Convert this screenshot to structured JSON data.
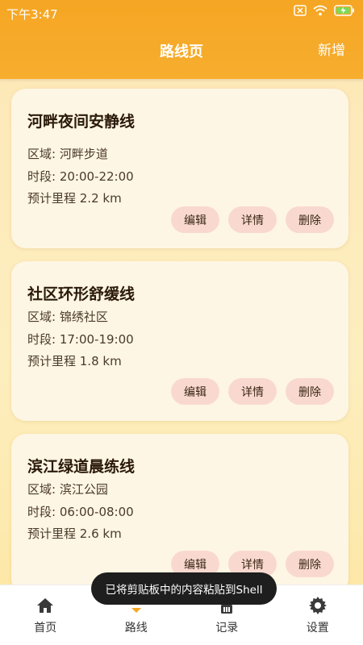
{
  "status_bar": {
    "time": "下午3:47"
  },
  "header": {
    "title": "路线页",
    "add_label": "新增"
  },
  "routes": [
    {
      "name": "河畔夜间安静线",
      "area": "区域: 河畔步道",
      "time": "时段: 20:00-22:00",
      "distance": "预计里程 2.2 km"
    },
    {
      "name": "社区环形舒缓线",
      "area": "区域: 锦绣社区",
      "time": "时段: 17:00-19:00",
      "distance": "预计里程 1.8 km"
    },
    {
      "name": "滨江绿道晨练线",
      "area": "区域: 滨江公园",
      "time": "时段: 06:00-08:00",
      "distance": "预计里程 2.6 km"
    }
  ],
  "actions": {
    "edit": "编辑",
    "details": "详情",
    "delete": "删除"
  },
  "tabs": [
    {
      "label": "首页",
      "icon": "home-icon"
    },
    {
      "label": "路线",
      "icon": "route-icon"
    },
    {
      "label": "记录",
      "icon": "record-icon"
    },
    {
      "label": "设置",
      "icon": "gear-icon"
    }
  ],
  "toast": {
    "text": "已将剪贴板中的内容粘贴到Shell"
  },
  "colors": {
    "header": "#f5a623",
    "card": "#fef6e4",
    "pill": "#f9d9cf",
    "active_tab": "#f5a623"
  }
}
